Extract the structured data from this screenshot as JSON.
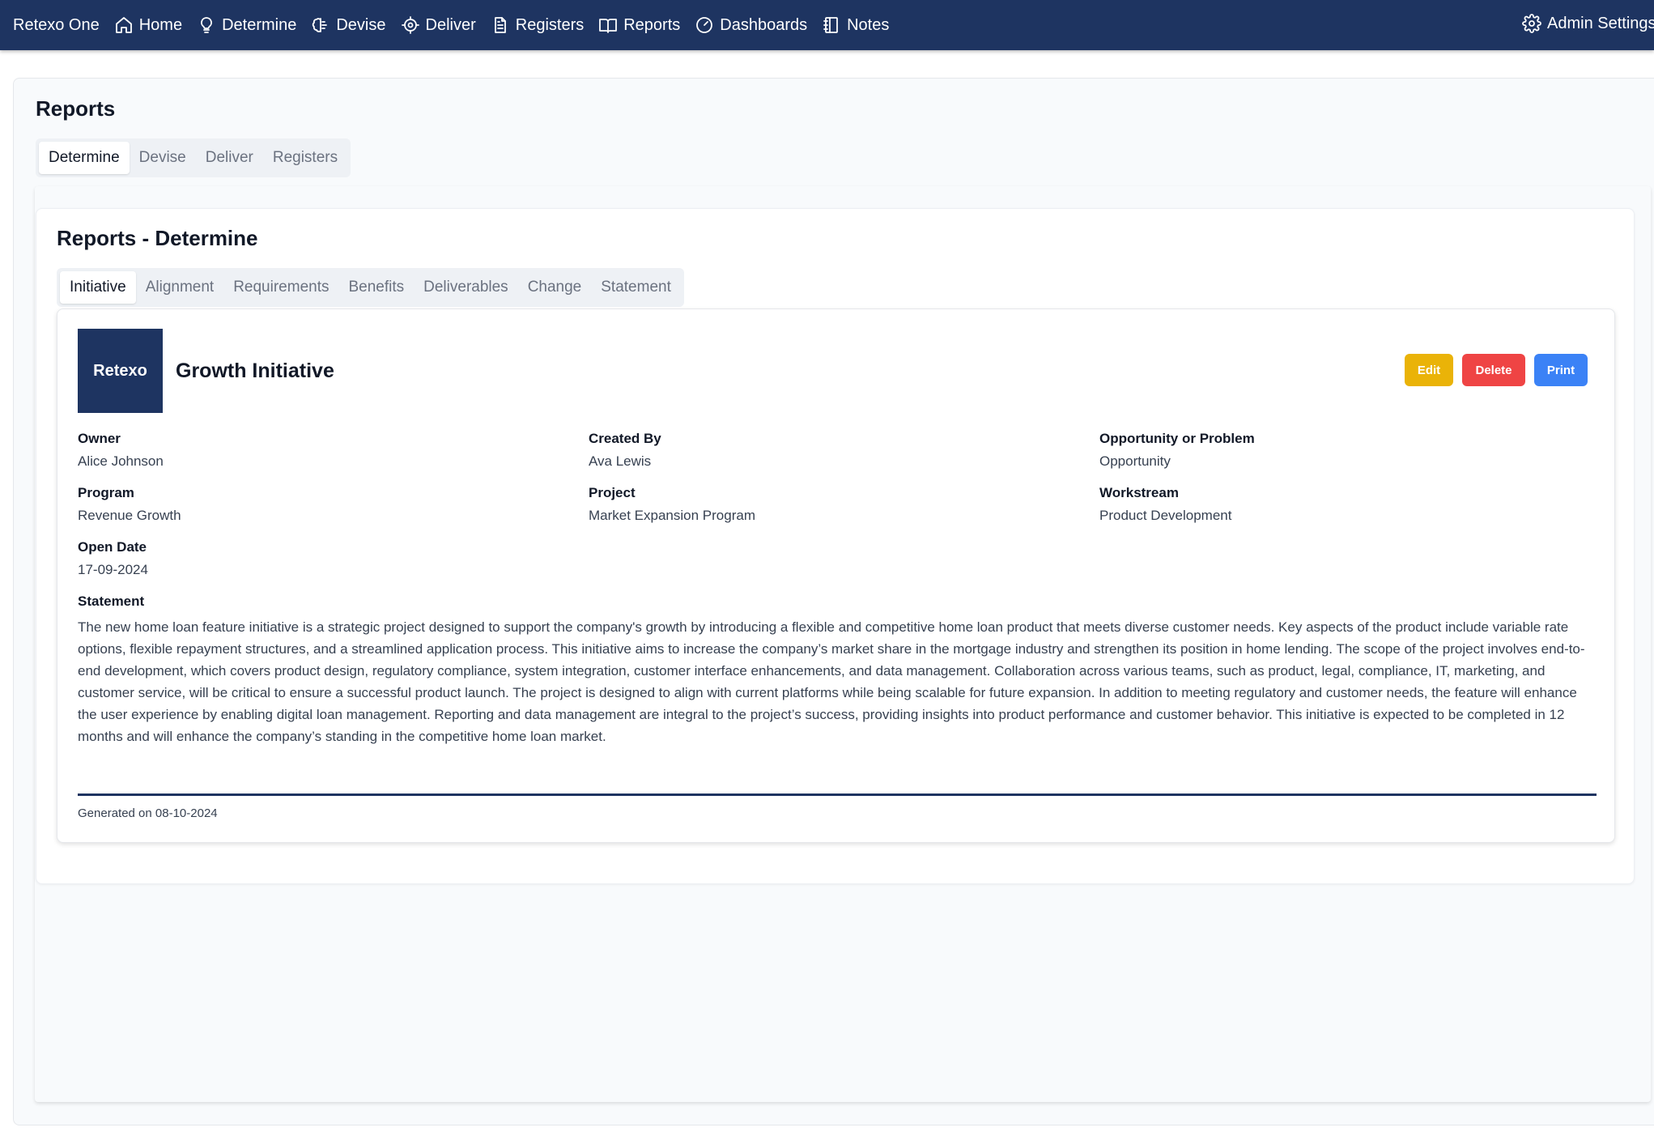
{
  "nav": {
    "brand": "Retexo One",
    "items": [
      {
        "label": "Home",
        "icon": "home-icon"
      },
      {
        "label": "Determine",
        "icon": "lightbulb-icon"
      },
      {
        "label": "Devise",
        "icon": "brain-icon"
      },
      {
        "label": "Deliver",
        "icon": "target-icon"
      },
      {
        "label": "Registers",
        "icon": "file-text-icon"
      },
      {
        "label": "Reports",
        "icon": "book-open-icon"
      },
      {
        "label": "Dashboards",
        "icon": "gauge-icon"
      },
      {
        "label": "Notes",
        "icon": "notebook-icon"
      }
    ],
    "admin": {
      "label": "Admin Settings",
      "icon": "gear-icon"
    }
  },
  "page": {
    "title": "Reports",
    "tabs": [
      "Determine",
      "Devise",
      "Deliver",
      "Registers"
    ],
    "active_tab": "Determine"
  },
  "section": {
    "title": "Reports - Determine",
    "tabs": [
      "Initiative",
      "Alignment",
      "Requirements",
      "Benefits",
      "Deliverables",
      "Change",
      "Statement"
    ],
    "active_tab": "Initiative"
  },
  "report": {
    "logo_text": "Retexo",
    "title": "Growth Initiative",
    "buttons": {
      "edit": "Edit",
      "delete": "Delete",
      "print": "Print"
    },
    "fields": {
      "owner": {
        "label": "Owner",
        "value": "Alice Johnson"
      },
      "created_by": {
        "label": "Created By",
        "value": "Ava Lewis"
      },
      "opportunity": {
        "label": "Opportunity or Problem",
        "value": "Opportunity"
      },
      "program": {
        "label": "Program",
        "value": "Revenue Growth"
      },
      "project": {
        "label": "Project",
        "value": "Market Expansion Program"
      },
      "workstream": {
        "label": "Workstream",
        "value": "Product Development"
      },
      "open_date": {
        "label": "Open Date",
        "value": "17-09-2024"
      }
    },
    "statement_label": "Statement",
    "statement_text": "The new home loan feature initiative is a strategic project designed to support the company's growth by introducing a flexible and competitive home loan product that meets diverse customer needs. Key aspects of the product include variable rate options, flexible repayment structures, and a streamlined application process. This initiative aims to increase the company’s market share in the mortgage industry and strengthen its position in home lending. The scope of the project involves end-to-end development, which covers product design, regulatory compliance, system integration, customer interface enhancements, and data management. Collaboration across various teams, such as product, legal, compliance, IT, marketing, and customer service, will be critical to ensure a successful product launch. The project is designed to align with current platforms while being scalable for future expansion. In addition to meeting regulatory and customer needs, the feature will enhance the user experience by enabling digital loan management. Reporting and data management are integral to the project’s success, providing insights into product performance and customer behavior. This initiative is expected to be completed in 12 months and will enhance the company’s standing in the competitive home loan market.",
    "generated": "Generated on 08-10-2024"
  },
  "colors": {
    "nav_bg": "#1e3461",
    "edit": "#eab308",
    "delete": "#ef4444",
    "print": "#3b82f6"
  }
}
